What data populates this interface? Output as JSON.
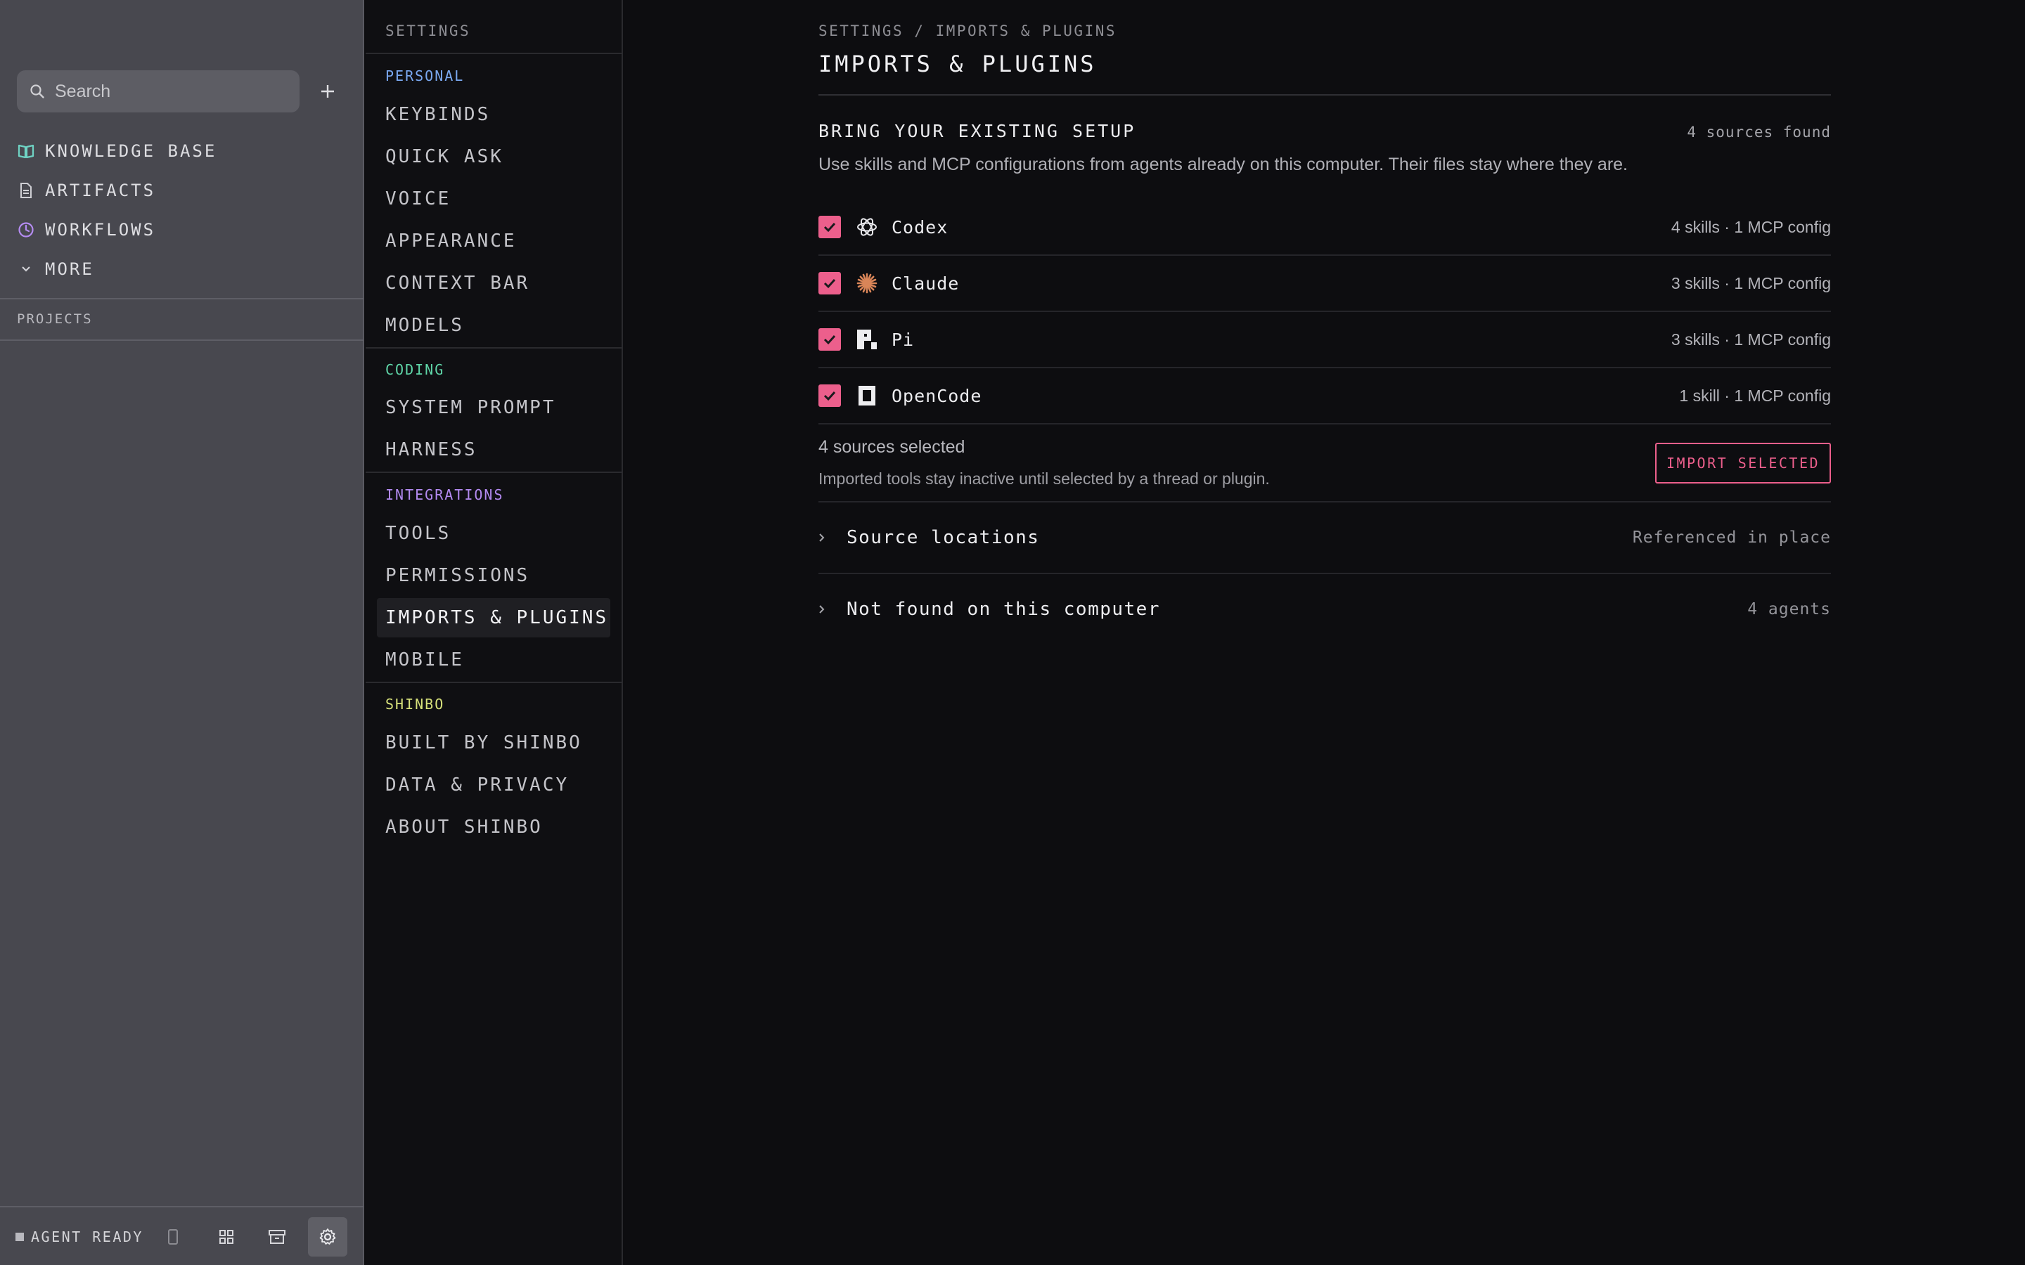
{
  "sidebar": {
    "search_placeholder": "Search",
    "nav": [
      {
        "label": "KNOWLEDGE BASE",
        "icon": "book-icon",
        "color": "#6fd3c4"
      },
      {
        "label": "ARTIFACTS",
        "icon": "document-icon",
        "color": "#cfcfd4"
      },
      {
        "label": "WORKFLOWS",
        "icon": "clock-icon",
        "color": "#b58cf2"
      },
      {
        "label": "MORE",
        "icon": "chevron-down-icon",
        "color": "#cfcfd4"
      }
    ],
    "projects_label": "PROJECTS",
    "agent_status": "AGENT READY"
  },
  "settings_nav": {
    "title": "SETTINGS",
    "groups": [
      {
        "label": "PERSONAL",
        "color": "#7aa8f0",
        "items": [
          "KEYBINDS",
          "QUICK ASK",
          "VOICE",
          "APPEARANCE",
          "CONTEXT BAR",
          "MODELS"
        ]
      },
      {
        "label": "CODING",
        "color": "#5fd6a8",
        "items": [
          "SYSTEM PROMPT",
          "HARNESS"
        ]
      },
      {
        "label": "INTEGRATIONS",
        "color": "#b38af0",
        "items": [
          "TOOLS",
          "PERMISSIONS",
          "IMPORTS & PLUGINS",
          "MOBILE"
        ]
      },
      {
        "label": "SHINBO",
        "color": "#d6e07a",
        "items": [
          "BUILT BY SHINBO",
          "DATA & PRIVACY",
          "ABOUT SHINBO"
        ]
      }
    ],
    "active_item": "IMPORTS & PLUGINS"
  },
  "main": {
    "breadcrumb": "SETTINGS / IMPORTS & PLUGINS",
    "title": "IMPORTS & PLUGINS",
    "section_title": "BRING YOUR EXISTING SETUP",
    "sources_found": "4 sources found",
    "description": "Use skills and MCP configurations from agents already on this computer. Their files stay where they are.",
    "sources": [
      {
        "name": "Codex",
        "meta": "4 skills · 1 MCP config",
        "icon": "openai-icon",
        "checked": true
      },
      {
        "name": "Claude",
        "meta": "3 skills · 1 MCP config",
        "icon": "claude-starburst-icon",
        "checked": true
      },
      {
        "name": "Pi",
        "meta": "3 skills · 1 MCP config",
        "icon": "pi-logo-icon",
        "checked": true
      },
      {
        "name": "OpenCode",
        "meta": "1 skill · 1 MCP config",
        "icon": "opencode-logo-icon",
        "checked": true
      }
    ],
    "selected_count": "4 sources selected",
    "selected_note": "Imported tools stay inactive until selected by a thread or plugin.",
    "import_button": "IMPORT SELECTED",
    "expanders": [
      {
        "label": "Source locations",
        "meta": "Referenced in place"
      },
      {
        "label": "Not found on this computer",
        "meta": "4 agents"
      }
    ],
    "accent": "#ec5f8c"
  }
}
